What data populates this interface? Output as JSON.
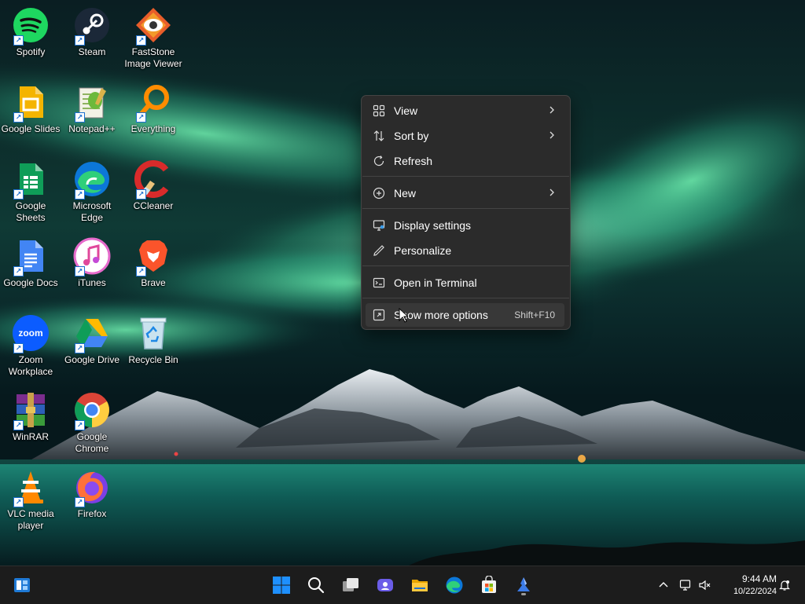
{
  "desktop": {
    "icons": [
      {
        "label": "Spotify",
        "icon": "spotify-icon"
      },
      {
        "label": "Steam",
        "icon": "steam-icon"
      },
      {
        "label": "FastStone Image Viewer",
        "icon": "faststone-icon"
      },
      {
        "label": "Google Slides",
        "icon": "google-slides-icon"
      },
      {
        "label": "Notepad++",
        "icon": "notepadpp-icon"
      },
      {
        "label": "Everything",
        "icon": "everything-search-icon"
      },
      {
        "label": "Google Sheets",
        "icon": "google-sheets-icon"
      },
      {
        "label": "Microsoft Edge",
        "icon": "edge-icon"
      },
      {
        "label": "CCleaner",
        "icon": "ccleaner-icon"
      },
      {
        "label": "Google Docs",
        "icon": "google-docs-icon"
      },
      {
        "label": "iTunes",
        "icon": "itunes-icon"
      },
      {
        "label": "Brave",
        "icon": "brave-icon"
      },
      {
        "label": "Zoom Workplace",
        "icon": "zoom-icon"
      },
      {
        "label": "Google Drive",
        "icon": "google-drive-icon"
      },
      {
        "label": "Recycle Bin",
        "icon": "recycle-bin-icon"
      },
      {
        "label": "WinRAR",
        "icon": "winrar-icon"
      },
      {
        "label": "Google Chrome",
        "icon": "chrome-icon"
      },
      {
        "label": "VLC media player",
        "icon": "vlc-icon"
      },
      {
        "label": "Firefox",
        "icon": "firefox-icon"
      }
    ]
  },
  "context_menu": {
    "items": [
      {
        "label": "View",
        "icon": "grid-view-icon",
        "submenu": true
      },
      {
        "label": "Sort by",
        "icon": "sort-icon",
        "submenu": true
      },
      {
        "label": "Refresh",
        "icon": "refresh-icon"
      },
      {
        "label": "New",
        "icon": "plus-circle-icon",
        "submenu": true
      },
      {
        "label": "Display settings",
        "icon": "display-settings-icon"
      },
      {
        "label": "Personalize",
        "icon": "pen-icon"
      },
      {
        "label": "Open in Terminal",
        "icon": "terminal-icon"
      },
      {
        "label": "Show more options",
        "icon": "more-options-icon",
        "accelerator": "Shift+F10",
        "hovered": true
      }
    ]
  },
  "taskbar": {
    "widgets_icon": "widgets-icon",
    "pinned": [
      {
        "name": "start-button",
        "icon": "windows-logo-icon"
      },
      {
        "name": "search-button",
        "icon": "search-icon"
      },
      {
        "name": "task-view-button",
        "icon": "task-view-icon"
      },
      {
        "name": "meet-button",
        "icon": "meet-icon"
      },
      {
        "name": "file-explorer-button",
        "icon": "folder-icon"
      },
      {
        "name": "edge-button",
        "icon": "edge-icon"
      },
      {
        "name": "store-button",
        "icon": "store-icon"
      },
      {
        "name": "app-button",
        "icon": "app-icon"
      }
    ],
    "tray": {
      "show_hidden_icon": "chevron-up-icon",
      "network_icon": "network-icon",
      "volume_icon": "volume-muted-icon",
      "notification_icon": "notification-bell-icon"
    },
    "clock": {
      "time": "9:44 AM",
      "date": "10/22/2024"
    }
  },
  "colors": {
    "menu_bg": "#2b2b2b",
    "menu_hover": "#383838",
    "taskbar_bg": "#1c1c1c",
    "windows_blue": "#1e90ff"
  }
}
